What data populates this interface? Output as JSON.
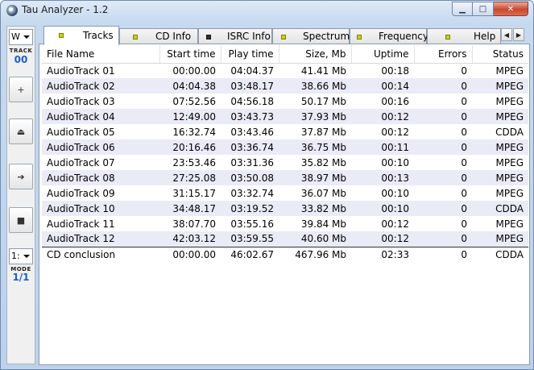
{
  "window": {
    "title": "Tau Analyzer - 1.2",
    "caption_buttons": {
      "minimize": "▁",
      "maximize": "□",
      "close": "✕"
    }
  },
  "toolbar": {
    "top_combo": "W",
    "track_label": "TRACK",
    "track_value": "00",
    "buttons": [
      {
        "name": "add-button",
        "glyph": "+"
      },
      {
        "name": "eject-button",
        "glyph": "⏏"
      },
      {
        "name": "play-button",
        "glyph": "➔"
      },
      {
        "name": "stop-button",
        "glyph": "■"
      }
    ],
    "bottom_combo": "1:",
    "mode_label": "MODE",
    "mode_value": "1/1"
  },
  "tabs": [
    {
      "label": "Tracks",
      "active": true
    },
    {
      "label": "CD Info",
      "active": false
    },
    {
      "label": "ISRC Info",
      "active": false
    },
    {
      "label": "Spectrum",
      "active": false
    },
    {
      "label": "Frequency",
      "active": false
    },
    {
      "label": "Help",
      "active": false
    }
  ],
  "table": {
    "columns": [
      "File Name",
      "Start time",
      "Play time",
      "Size, Mb",
      "Uptime",
      "Errors",
      "Status"
    ],
    "rows": [
      [
        "AudioTrack 01",
        "00:00.00",
        "04:04.37",
        "41.41 Mb",
        "00:18",
        "0",
        "MPEG"
      ],
      [
        "AudioTrack 02",
        "04:04.38",
        "03:48.17",
        "38.66 Mb",
        "00:14",
        "0",
        "MPEG"
      ],
      [
        "AudioTrack 03",
        "07:52.56",
        "04:56.18",
        "50.17 Mb",
        "00:16",
        "0",
        "MPEG"
      ],
      [
        "AudioTrack 04",
        "12:49.00",
        "03:43.73",
        "37.93 Mb",
        "00:12",
        "0",
        "MPEG"
      ],
      [
        "AudioTrack 05",
        "16:32.74",
        "03:43.46",
        "37.87 Mb",
        "00:12",
        "0",
        "CDDA"
      ],
      [
        "AudioTrack 06",
        "20:16.46",
        "03:36.74",
        "36.75 Mb",
        "00:11",
        "0",
        "MPEG"
      ],
      [
        "AudioTrack 07",
        "23:53.46",
        "03:31.36",
        "35.82 Mb",
        "00:10",
        "0",
        "MPEG"
      ],
      [
        "AudioTrack 08",
        "27:25.08",
        "03:50.08",
        "38.97 Mb",
        "00:13",
        "0",
        "MPEG"
      ],
      [
        "AudioTrack 09",
        "31:15.17",
        "03:32.74",
        "36.07 Mb",
        "00:10",
        "0",
        "MPEG"
      ],
      [
        "AudioTrack 10",
        "34:48.17",
        "03:19.52",
        "33.82 Mb",
        "00:10",
        "0",
        "CDDA"
      ],
      [
        "AudioTrack 11",
        "38:07.70",
        "03:55.16",
        "39.84 Mb",
        "00:12",
        "0",
        "MPEG"
      ],
      [
        "AudioTrack 12",
        "42:03.12",
        "03:59.55",
        "40.60 Mb",
        "00:12",
        "0",
        "MPEG"
      ]
    ],
    "conclusion": [
      "CD conclusion",
      "00:00.00",
      "46:02.67",
      "467.96 Mb",
      "02:33",
      "0",
      "CDDA"
    ]
  }
}
